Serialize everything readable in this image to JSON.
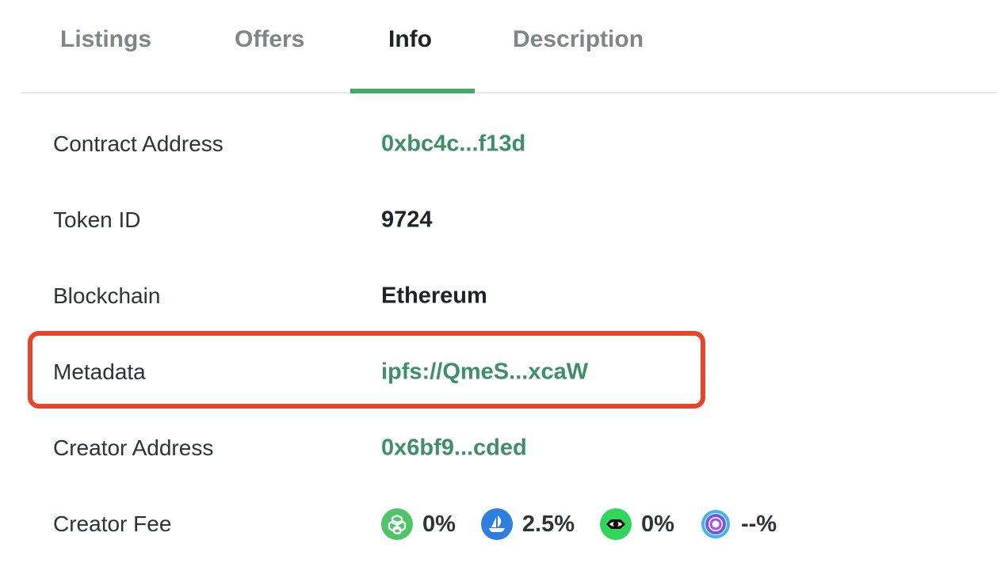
{
  "tabs": [
    {
      "label": "Listings",
      "active": false
    },
    {
      "label": "Offers",
      "active": false
    },
    {
      "label": "Info",
      "active": true
    },
    {
      "label": "Description",
      "active": false
    }
  ],
  "info": {
    "contract_address": {
      "label": "Contract Address",
      "value": "0xbc4c...f13d"
    },
    "token_id": {
      "label": "Token ID",
      "value": "9724"
    },
    "blockchain": {
      "label": "Blockchain",
      "value": "Ethereum"
    },
    "metadata": {
      "label": "Metadata",
      "value": "ipfs://QmeS...xcaW"
    },
    "creator_address": {
      "label": "Creator Address",
      "value": "0x6bf9...cded"
    },
    "creator_fee": {
      "label": "Creator Fee",
      "fees": [
        {
          "icon": "looksrare-icon",
          "value": "0%",
          "color": "#4fc46a"
        },
        {
          "icon": "opensea-icon",
          "value": "2.5%",
          "color": "#2f7fe0"
        },
        {
          "icon": "looksrare-eye-icon",
          "value": "0%",
          "color": "#31d45c"
        },
        {
          "icon": "x2y2-ring-icon",
          "value": "--%",
          "color": "#6a5ce8"
        }
      ]
    }
  },
  "colors": {
    "accent": "#46a96b",
    "link": "#3f8f66",
    "highlight_border": "#e8442a"
  }
}
